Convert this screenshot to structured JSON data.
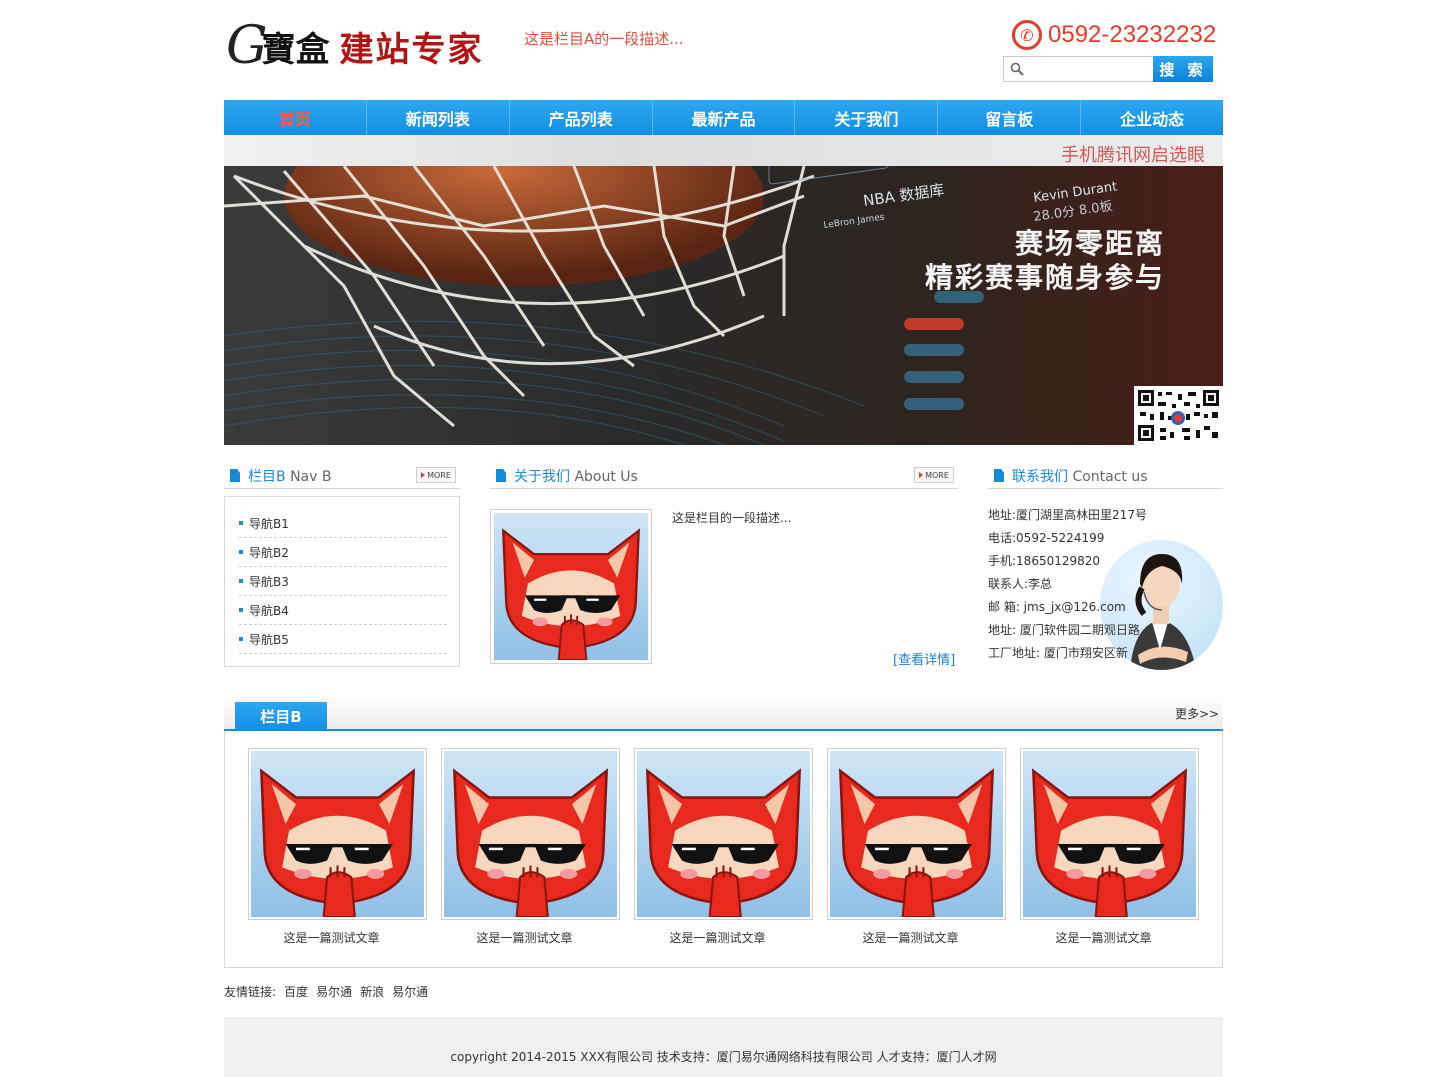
{
  "header": {
    "logo_g": "G",
    "logo_chars": "寶盒",
    "logo_slogan": "建站专家",
    "description": "这是栏目A的一段描述...",
    "phone": "0592-23232232",
    "search_button": "搜 索",
    "search_placeholder": "",
    "accent_color": "#e43b2b"
  },
  "nav": {
    "items": [
      "首页",
      "新闻列表",
      "产品列表",
      "最新产品",
      "关于我们",
      "留言板",
      "企业动态"
    ],
    "active_color": "#ff5a3c",
    "bar_color": "#1a96e6"
  },
  "banner": {
    "top_strip_text": "手机腾讯网启选眼",
    "line1": "赛场零距离",
    "line2": "精彩赛事随身参与",
    "nba_label": "NBA 数据库",
    "player1": "LeBron James",
    "player2": "Kevin Durant",
    "stat2": "28.0分 8.0板"
  },
  "navb": {
    "title": "栏目B",
    "title_en": "Nav B",
    "more": "MORE",
    "items": [
      "导航B1",
      "导航B2",
      "导航B3",
      "导航B4",
      "导航B5"
    ]
  },
  "about": {
    "title": "关于我们",
    "title_en": "About Us",
    "more": "MORE",
    "description": "这是栏目的一段描述...",
    "detail_link": "[查看详情]"
  },
  "contact": {
    "title": "联系我们",
    "title_en": "Contact us",
    "lines": [
      "地址:厦门湖里高林田里217号",
      "电话:0592-5224199",
      "手机:18650129820",
      "联系人:李总",
      "邮 箱: jms_jx@126.com",
      "地址: 厦门软件园二期观日路",
      "工厂地址: 厦门市翔安区新"
    ]
  },
  "products": {
    "tab": "栏目B",
    "more": "更多>>",
    "items": [
      "这是一篇测试文章",
      "这是一篇测试文章",
      "这是一篇测试文章",
      "这是一篇测试文章",
      "这是一篇测试文章"
    ]
  },
  "links": {
    "label": "友情链接:",
    "items": [
      "百度",
      "易尔通",
      "新浪",
      "易尔通"
    ]
  },
  "footer": {
    "text": "copyright 2014-2015 XXX有限公司 技术支持：厦门易尔通网络科技有限公司 人才支持：厦门人才网"
  }
}
